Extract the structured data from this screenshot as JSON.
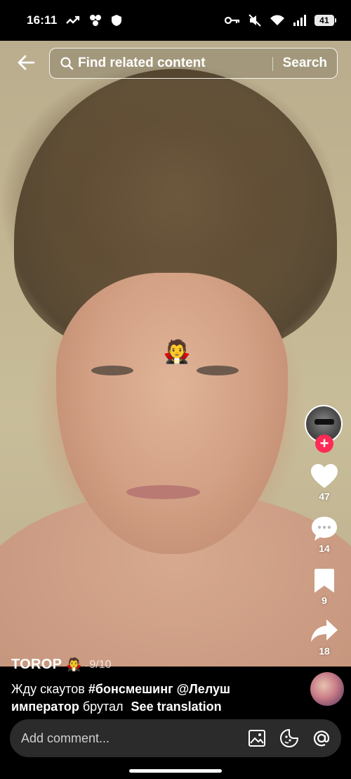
{
  "status_bar": {
    "time": "16:11",
    "battery": "41",
    "icons": [
      "missed-call-icon",
      "bubbles-icon",
      "shield-icon",
      "key-icon",
      "mute-icon",
      "wifi-icon",
      "signal-icon",
      "battery-icon"
    ]
  },
  "video": {
    "sticker": "🧛"
  },
  "search": {
    "placeholder": "Find related content",
    "button_label": "Search"
  },
  "actions": {
    "likes": "47",
    "comments": "14",
    "saves": "9",
    "shares": "18",
    "follow_label": "+"
  },
  "post": {
    "author": "TOROP",
    "author_emoji": "🧛",
    "separator": "·",
    "index": "9/10",
    "caption_text_1": "Жду скаутов ",
    "caption_hashtag": "#бонсмешинг",
    "caption_mention": "@Лелуш император",
    "caption_text_2": " брутал",
    "see_translation": "See translation"
  },
  "comment_bar": {
    "placeholder": "Add comment..."
  },
  "colors": {
    "accent": "#fe2c55",
    "background": "#000000",
    "input_bg": "#2b2b2b"
  }
}
